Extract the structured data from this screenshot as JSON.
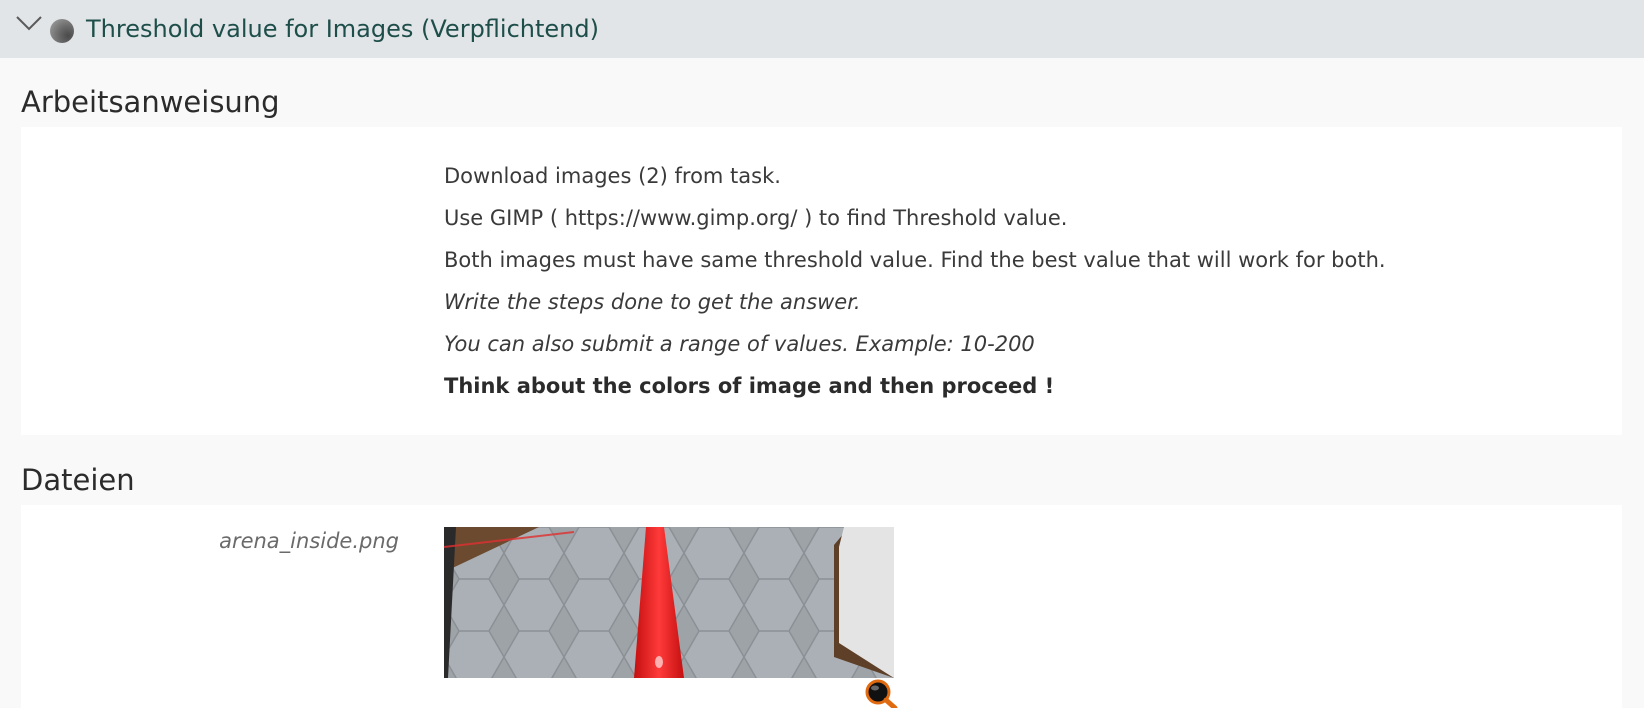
{
  "task": {
    "title": "Threshold value for Images (Verpflichtend)",
    "expanded_icon": "chevron-down-icon",
    "status_icon": "status-dot-icon",
    "title_color": "#1e4e4a",
    "header_background": "#e1e5e8"
  },
  "instructions": {
    "heading": "Arbeitsanweisung",
    "lines": [
      {
        "text": "Download images (2) from task.",
        "style": "normal"
      },
      {
        "text": "Use GIMP ( https://www.gimp.org/ ) to find Threshold value.",
        "style": "normal"
      },
      {
        "text": "Both images must have same threshold value. Find the best value that will work for both.",
        "style": "normal"
      },
      {
        "text": "Write the steps done to get the answer.",
        "style": "italic"
      },
      {
        "text": "You can also submit a range of values. Example: 10-200",
        "style": "italic"
      },
      {
        "text": "Think about the colors of image and then proceed !",
        "style": "bold"
      }
    ]
  },
  "files": {
    "heading": "Dateien",
    "items": [
      {
        "filename": "arena_inside.png",
        "zoom_icon": "magnifier-zoom-icon"
      }
    ]
  }
}
